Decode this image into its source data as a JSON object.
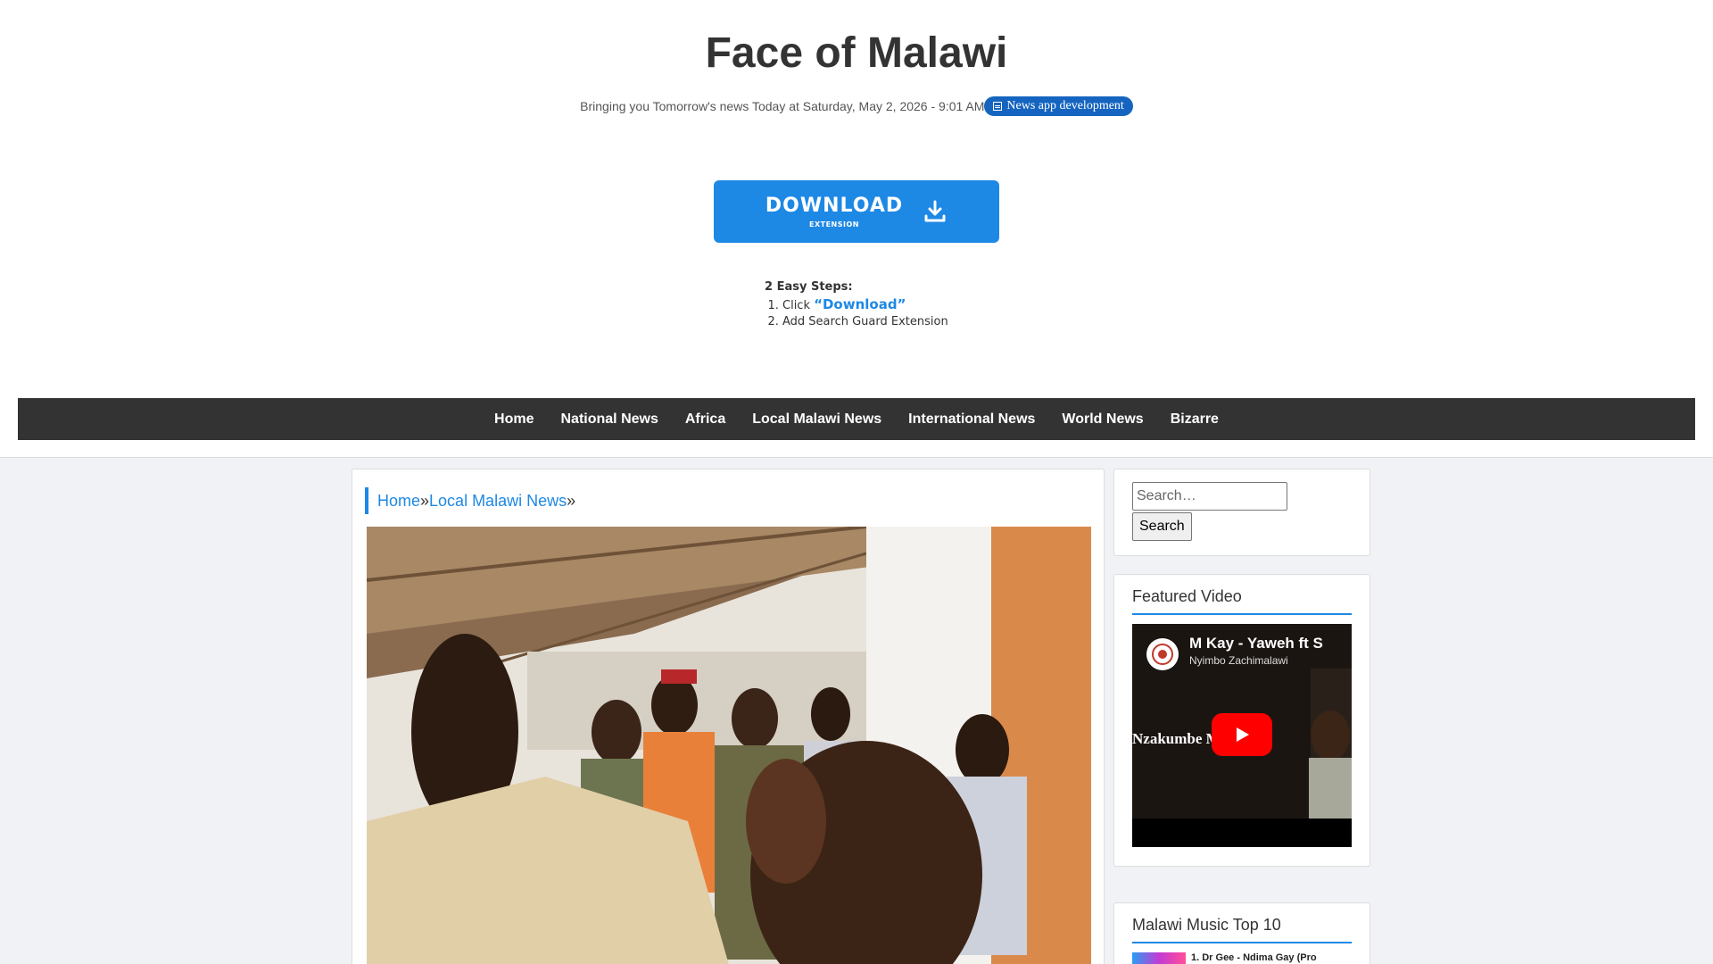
{
  "header": {
    "site_title": "Face of Malawi",
    "tagline": "Bringing you Tomorrow's news Today at Saturday, May 2, 2026 - 9:01 AM",
    "pill_label": "News app development"
  },
  "ad": {
    "download_label": "DOWNLOAD",
    "download_sub": "EXTENSION",
    "steps_title": "2 Easy Steps:",
    "step1_prefix": "Click ",
    "step1_link": "“Download”",
    "step2": "Add Search Guard Extension",
    "accent": "#1e88e5"
  },
  "nav": {
    "items": [
      "Home",
      "National News",
      "Africa",
      "Local Malawi News",
      "International News",
      "World News",
      "Bizarre"
    ]
  },
  "breadcrumb": {
    "home": "Home",
    "sep": "»",
    "category": "Local Malawi News"
  },
  "sidebar": {
    "search_placeholder": "Search…",
    "search_button": "Search",
    "featured_title": "Featured Video",
    "video_title": "M Kay - Yaweh ft S",
    "video_channel": "Nyimbo Zachimalawi",
    "video_overlay": "Nzakumbe Messiah",
    "music_title": "Malawi Music Top 10",
    "music_first": "1. Dr Gee - Ndima Gay (Pro"
  },
  "colors": {
    "nav_bg": "#333333",
    "accent": "#1e88e5",
    "youtube_red": "#ff0000"
  }
}
